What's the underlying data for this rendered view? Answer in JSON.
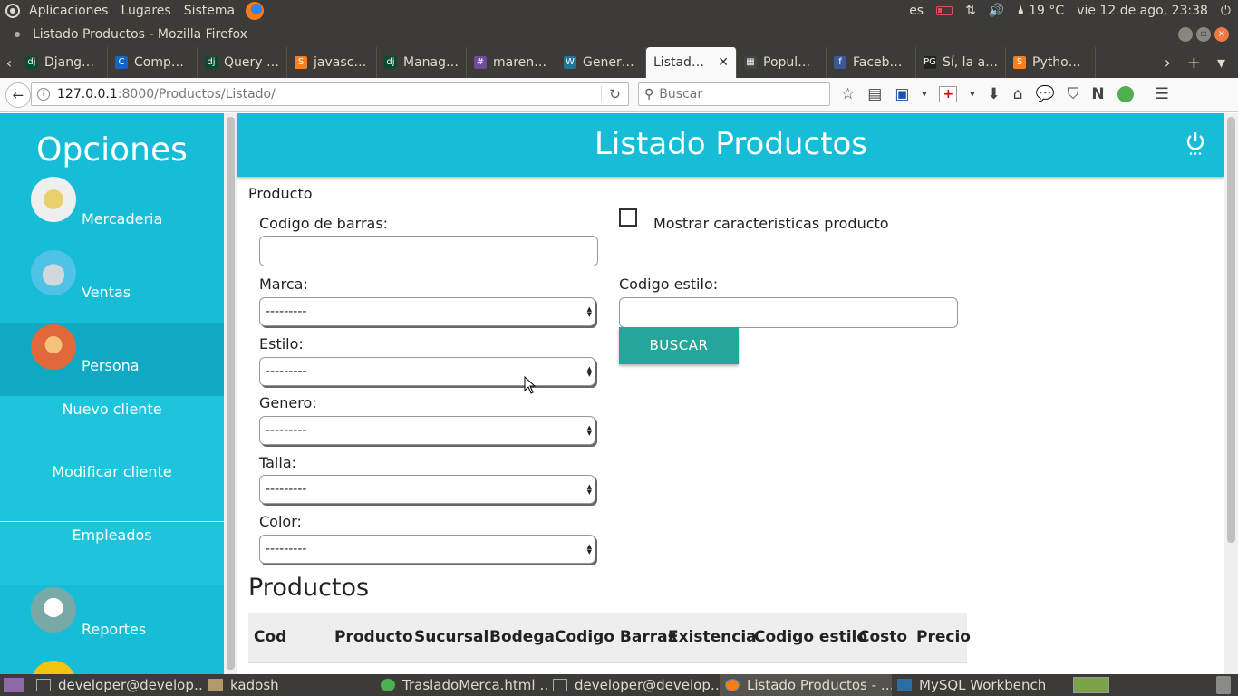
{
  "top_panel": {
    "menus": [
      "Aplicaciones",
      "Lugares",
      "Sistema"
    ],
    "lang": "es",
    "weather": "19 °C",
    "datetime": "vie 12 de ago, 23:38",
    "icons": [
      "ubuntu-logo-icon",
      "firefox-icon",
      "battery-icon",
      "network-icon",
      "volume-icon",
      "weather-icon",
      "power-icon"
    ]
  },
  "window": {
    "title": "Listado Productos - Mozilla Firefox"
  },
  "tabs": [
    {
      "label": "Djang…",
      "color": "#0c4b33",
      "icon": "dj"
    },
    {
      "label": "Comp…",
      "color": "#1565c0",
      "icon": "C"
    },
    {
      "label": "Query …",
      "color": "#0c4b33",
      "icon": "dj"
    },
    {
      "label": "javasc…",
      "color": "#f48024",
      "icon": "S"
    },
    {
      "label": "Manag…",
      "color": "#0c4b33",
      "icon": "dj"
    },
    {
      "label": "maren…",
      "color": "#6d4c9f",
      "icon": "#"
    },
    {
      "label": "Gener…",
      "color": "#21759b",
      "icon": "W"
    },
    {
      "label": "Listad…",
      "color": "",
      "icon": "",
      "active": true
    },
    {
      "label": "Popul…",
      "color": "#444444",
      "icon": "▦"
    },
    {
      "label": "Faceb…",
      "color": "#3b5998",
      "icon": "f"
    },
    {
      "label": "Sí, la a…",
      "color": "#222222",
      "icon": "PG"
    },
    {
      "label": "Pytho…",
      "color": "#f48024",
      "icon": "S"
    }
  ],
  "navbar": {
    "url_host": "127.0.0.1",
    "url_path": ":8000/Productos/Listado/",
    "search_placeholder": "Buscar"
  },
  "sidebar": {
    "title": "Opciones",
    "items": [
      {
        "label": "Mercaderia"
      },
      {
        "label": "Ventas"
      },
      {
        "label": "Persona"
      },
      {
        "label": "Reportes"
      }
    ],
    "subitems": [
      "Nuevo cliente",
      "Modificar cliente",
      "Empleados"
    ]
  },
  "header": {
    "title": "Listado Productos"
  },
  "form": {
    "legend": "Producto",
    "barcode_label": "Codigo de barras:",
    "barcode_value": "",
    "show_features_label": "Mostrar caracteristicas producto",
    "show_features_checked": false,
    "style_code_label": "Codigo estilo:",
    "style_code_value": "",
    "selects": [
      {
        "label": "Marca:",
        "value": "---------"
      },
      {
        "label": "Estilo:",
        "value": "---------"
      },
      {
        "label": "Genero:",
        "value": "---------"
      },
      {
        "label": "Talla:",
        "value": "---------"
      },
      {
        "label": "Color:",
        "value": "---------"
      }
    ],
    "search_button": "BUSCAR"
  },
  "products": {
    "title": "Productos",
    "columns": [
      "Cod",
      "Producto",
      "Sucursal",
      "Bodega",
      "Codigo Barras",
      "Existencia",
      "Codigo estilo",
      "Costo",
      "Precio"
    ]
  },
  "taskbar": [
    {
      "label": "developer@develop…",
      "icon": "terminal"
    },
    {
      "label": "kadosh",
      "icon": "folder"
    },
    {
      "label": "TrasladoMerca.html …",
      "icon": "green"
    },
    {
      "label": "developer@develop…",
      "icon": "terminal"
    },
    {
      "label": "Listado Productos - …",
      "icon": "ff",
      "active": true
    },
    {
      "label": "MySQL Workbench",
      "icon": "mysql"
    }
  ],
  "colors": {
    "accent": "#17bdd7",
    "button": "#26a69a",
    "panel": "#3c3b37"
  }
}
